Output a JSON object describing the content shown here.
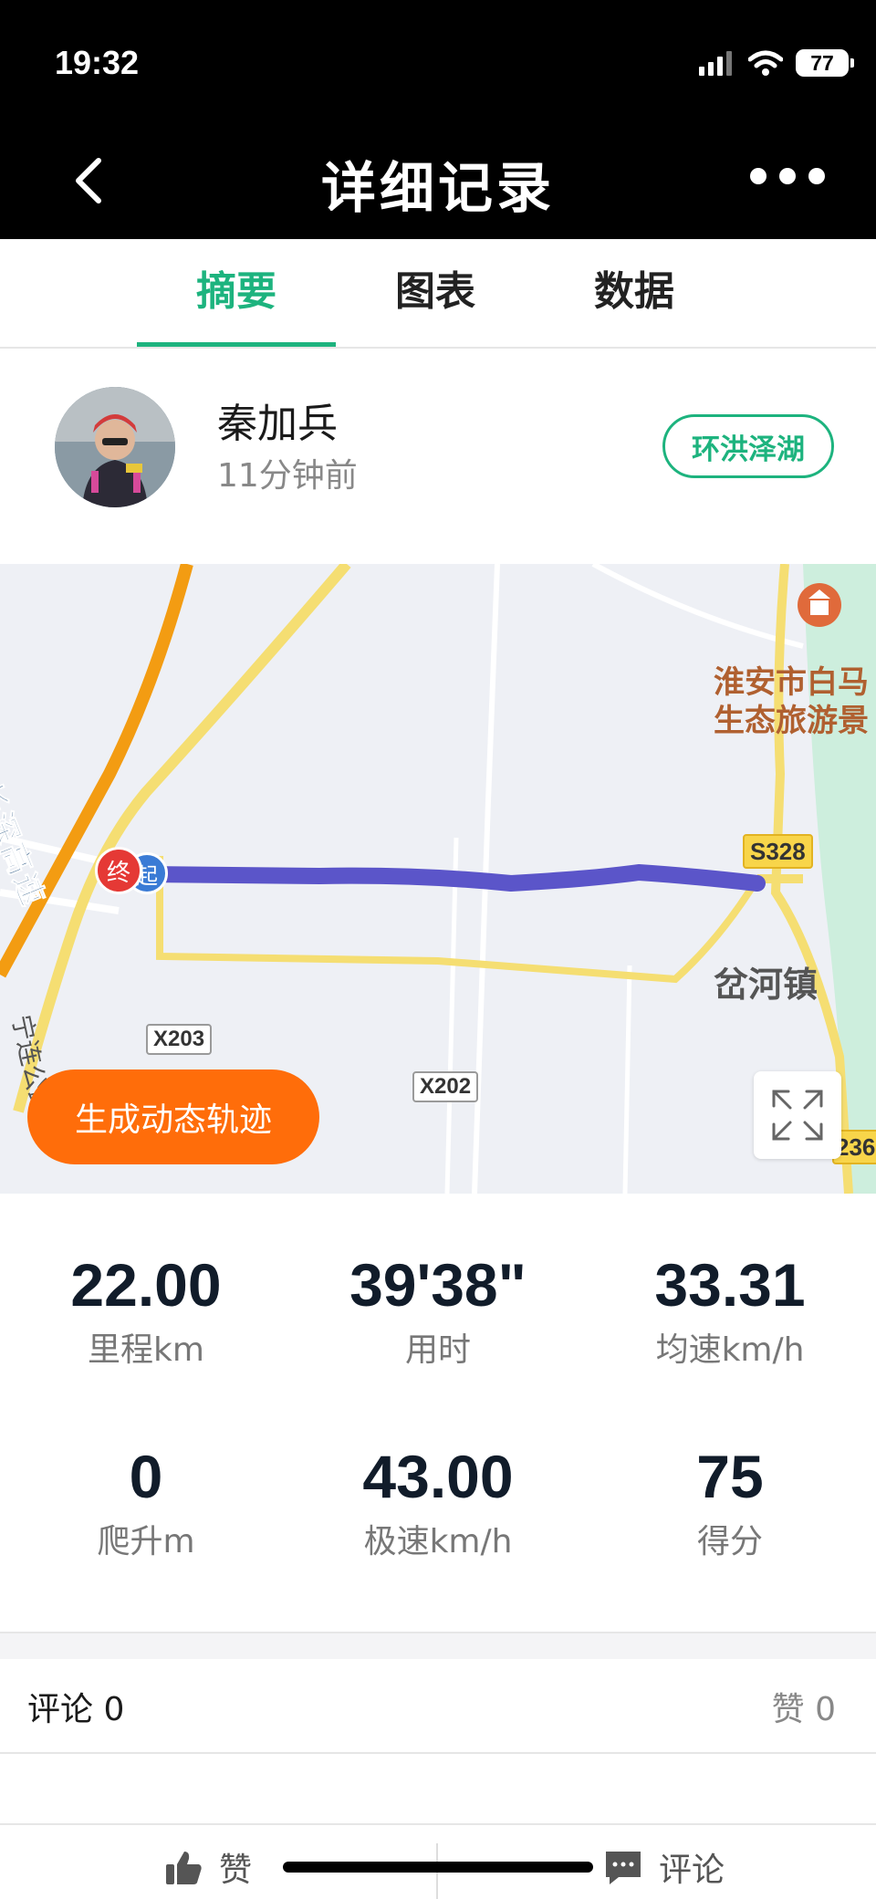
{
  "status_bar": {
    "time": "19:32",
    "battery": "77"
  },
  "nav": {
    "title": "详细记录"
  },
  "tabs": [
    {
      "label": "摘要",
      "active": true
    },
    {
      "label": "图表",
      "active": false
    },
    {
      "label": "数据",
      "active": false
    }
  ],
  "profile": {
    "name": "秦加兵",
    "time_ago": "11分钟前",
    "route_tag": "环洪泽湖"
  },
  "map": {
    "highway_label": "长深高速",
    "road_label_lower": "宁连公路",
    "poi_line1": "淮安市白马",
    "poi_line2": "生态旅游景",
    "town_label": "岔河镇",
    "badge_x203": "X203",
    "badge_x202": "X202",
    "badge_s328": "S328",
    "badge_s236_partial": "236",
    "end_marker": "终",
    "start_marker": "起",
    "generate_button": "生成动态轨迹"
  },
  "stats": [
    {
      "value": "22.00",
      "label": "里程km"
    },
    {
      "value": "39'38\"",
      "label": "用时"
    },
    {
      "value": "33.31",
      "label": "均速km/h"
    },
    {
      "value": "0",
      "label": "爬升m"
    },
    {
      "value": "43.00",
      "label": "极速km/h"
    },
    {
      "value": "75",
      "label": "得分"
    }
  ],
  "comments": {
    "comments_label": "评论 0",
    "likes_label": "赞 0"
  },
  "bottom_bar": {
    "like_label": "赞",
    "comment_label": "评论"
  },
  "colors": {
    "accent": "#1db37e",
    "orange": "#ff6d0a",
    "track": "#5b55c9"
  }
}
